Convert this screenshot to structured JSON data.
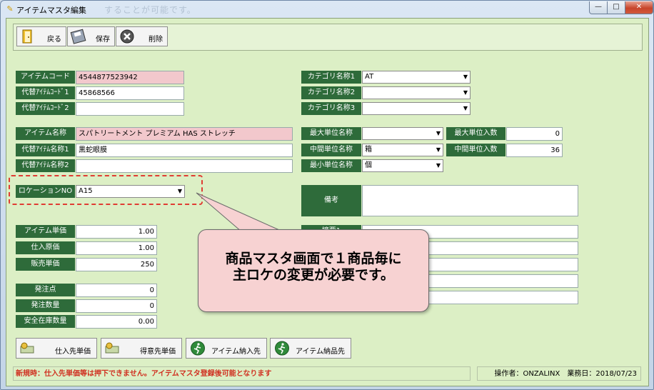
{
  "window": {
    "title": "アイテムマスタ編集",
    "ghost_text": "することが可能です。",
    "controls": {
      "min": "—",
      "max": "□",
      "close": "✕"
    }
  },
  "toolbar": {
    "back_label": "戻る",
    "save_label": "保存",
    "delete_label": "削除"
  },
  "left_form": {
    "item_code": {
      "label": "アイテムコード",
      "value": "4544877523942"
    },
    "alt_code1": {
      "label": "代替ｱｲﾃﾑｺｰﾄﾞ1",
      "value": "45868566"
    },
    "alt_code2": {
      "label": "代替ｱｲﾃﾑｺｰﾄﾞ2",
      "value": ""
    },
    "item_name": {
      "label": "アイテム名称",
      "value": "スパトリートメント プレミアム HAS ストレッチ"
    },
    "alt_name1": {
      "label": "代替ｱｲﾃﾑ名称1",
      "value": "黒蛇眼膜"
    },
    "alt_name2": {
      "label": "代替ｱｲﾃﾑ名称2",
      "value": ""
    },
    "location": {
      "label": "ロケーションNO",
      "value": "A15"
    },
    "unit_price": {
      "label": "アイテム単価",
      "value": "1.00"
    },
    "cost_price": {
      "label": "仕入原価",
      "value": "1.00"
    },
    "sell_price": {
      "label": "販売単価",
      "value": "250"
    },
    "order_point": {
      "label": "発注点",
      "value": "0"
    },
    "order_qty": {
      "label": "発注数量",
      "value": "0"
    },
    "safety_stock": {
      "label": "安全在庫数量",
      "value": "0.00"
    }
  },
  "right_form": {
    "category1": {
      "label": "カテゴリ名称1",
      "value": "AT"
    },
    "category2": {
      "label": "カテゴリ名称2",
      "value": ""
    },
    "category3": {
      "label": "カテゴリ名称3",
      "value": ""
    },
    "max_unit": {
      "label": "最大単位名称",
      "value": ""
    },
    "mid_unit": {
      "label": "中間単位名称",
      "value": "箱"
    },
    "min_unit": {
      "label": "最小単位名称",
      "value": "個"
    },
    "max_unit_qty": {
      "label": "最大単位入数",
      "value": "0"
    },
    "mid_unit_qty": {
      "label": "中間単位入数",
      "value": "36"
    },
    "remarks": {
      "label": "備考",
      "value": ""
    },
    "extra_label": "摘要1"
  },
  "bottom_buttons": {
    "supplier_price": "仕入先単価",
    "customer_price": "得意先単価",
    "item_inbound": "アイテム納入先",
    "item_delivery": "アイテム納品先"
  },
  "status": {
    "notice": "新規時：仕入先単価等は押下できません。アイテムマスタ登録後可能となります",
    "operator": "操作者：ONZALINX　業務日：2018/07/23"
  },
  "callout": {
    "line1": "商品マスタ画面で１商品毎に",
    "line2": "主ロケの変更が必要です。"
  },
  "icons": {
    "door": "door-icon",
    "disk": "floppy-disk-icon",
    "delete": "delete-x-icon",
    "money": "money-icon",
    "runner": "runner-icon"
  },
  "colors": {
    "label_bg": "#2e6b3a",
    "client_bg": "#dcefc5",
    "required_field": "#f2c8cc",
    "notice_text": "#d03020",
    "callout_bg": "#f7d2d2",
    "highlight_dash": "#e03c33"
  }
}
